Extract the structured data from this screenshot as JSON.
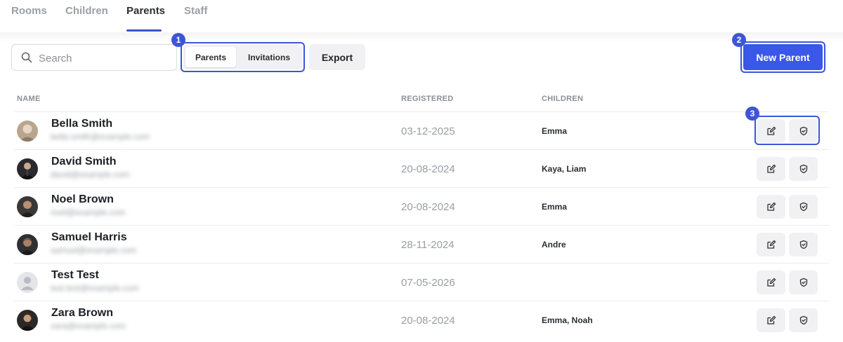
{
  "tabs": [
    {
      "label": "Rooms",
      "active": false
    },
    {
      "label": "Children",
      "active": false
    },
    {
      "label": "Parents",
      "active": true
    },
    {
      "label": "Staff",
      "active": false
    }
  ],
  "toolbar": {
    "search_placeholder": "Search",
    "segment": {
      "parents": "Parents",
      "invitations": "Invitations",
      "selected": "Parents"
    },
    "export_label": "Export",
    "new_parent_label": "New Parent"
  },
  "annotations": {
    "one": "1",
    "two": "2",
    "three": "3"
  },
  "table": {
    "columns": {
      "name": "NAME",
      "registered": "REGISTERED",
      "children": "CHILDREN"
    },
    "rows": [
      {
        "name": "Bella Smith",
        "email": "bella.smith@example.com",
        "registered": "03-12-2025",
        "children": "Emma",
        "avatar": "photo"
      },
      {
        "name": "David Smith",
        "email": "david@example.com",
        "registered": "20-08-2024",
        "children": "Kaya,  Liam",
        "avatar": "photo"
      },
      {
        "name": "Noel Brown",
        "email": "noel@example.com",
        "registered": "20-08-2024",
        "children": "Emma",
        "avatar": "photo"
      },
      {
        "name": "Samuel Harris",
        "email": "samuel@example.com",
        "registered": "28-11-2024",
        "children": "Andre",
        "avatar": "photo"
      },
      {
        "name": "Test Test",
        "email": "test.test@example.com",
        "registered": "07-05-2026",
        "children": "",
        "avatar": "placeholder"
      },
      {
        "name": "Zara Brown",
        "email": "zara@example.com",
        "registered": "20-08-2024",
        "children": "Emma,  Noah",
        "avatar": "photo"
      }
    ]
  },
  "icons": {
    "search": "search-icon",
    "edit": "edit-icon",
    "shield": "shield-icon"
  },
  "colors": {
    "accent": "#3a57e8",
    "highlight": "#3d55d6",
    "muted": "#9aa0a6"
  }
}
